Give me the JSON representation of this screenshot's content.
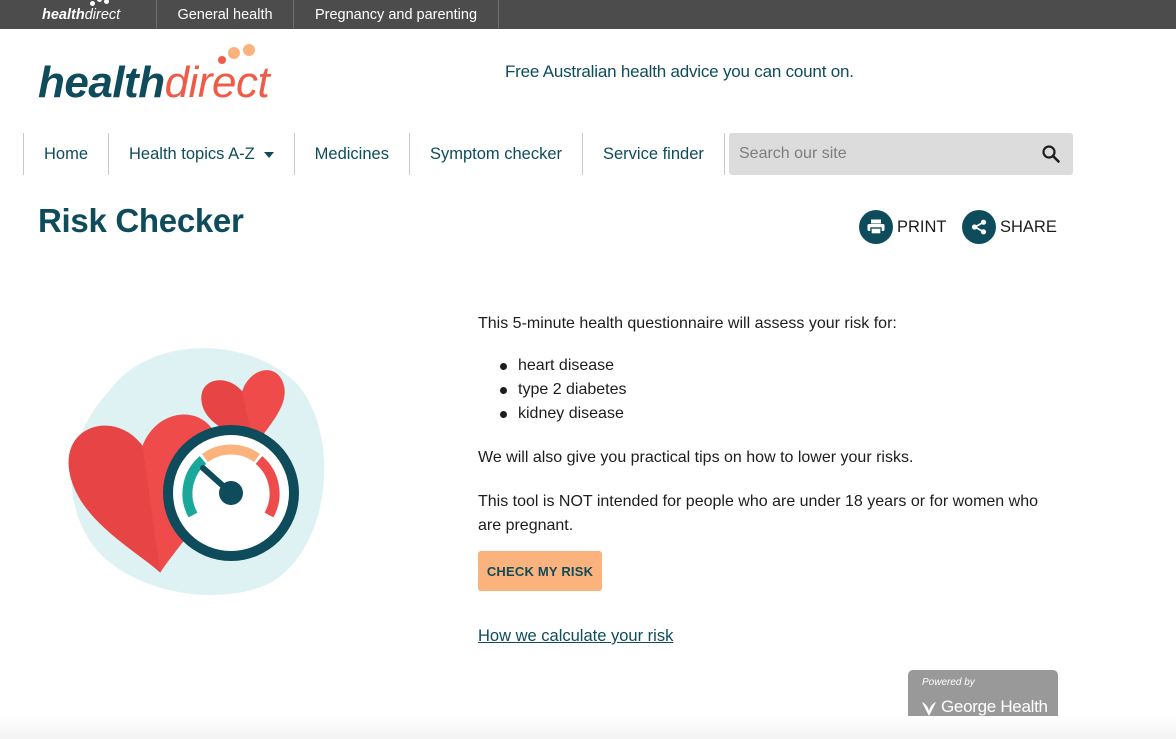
{
  "topbar": {
    "logo_bold": "health",
    "logo_light": "direct",
    "links": [
      "General health",
      "Pregnancy and parenting"
    ]
  },
  "header": {
    "logo_part1": "health",
    "logo_part2": "direct",
    "tagline": "Free Australian health advice you can count on."
  },
  "nav": {
    "items": [
      "Home",
      "Health topics A-Z",
      "Medicines",
      "Symptom checker",
      "Service finder"
    ],
    "search_placeholder": "Search our site"
  },
  "page": {
    "title": "Risk Checker",
    "print_label": "PRINT",
    "share_label": "SHARE"
  },
  "content": {
    "intro": "This 5-minute health questionnaire will assess your risk for:",
    "risks": [
      "heart disease",
      "type 2 diabetes",
      "kidney disease"
    ],
    "tips": "We will also give you practical tips on how to lower your risks.",
    "disclaimer": "This tool is NOT intended for people who are under 18 years or for women who are pregnant.",
    "cta_label": "CHECK MY RISK",
    "link_label": "How we calculate your risk"
  },
  "powered": {
    "label": "Powered by",
    "brand": "George Health"
  },
  "colors": {
    "brand_teal": "#0e4c5b",
    "brand_coral": "#ef5b48",
    "cta_orange": "#fbb27c",
    "topbar_gray": "#4c4c4c"
  }
}
